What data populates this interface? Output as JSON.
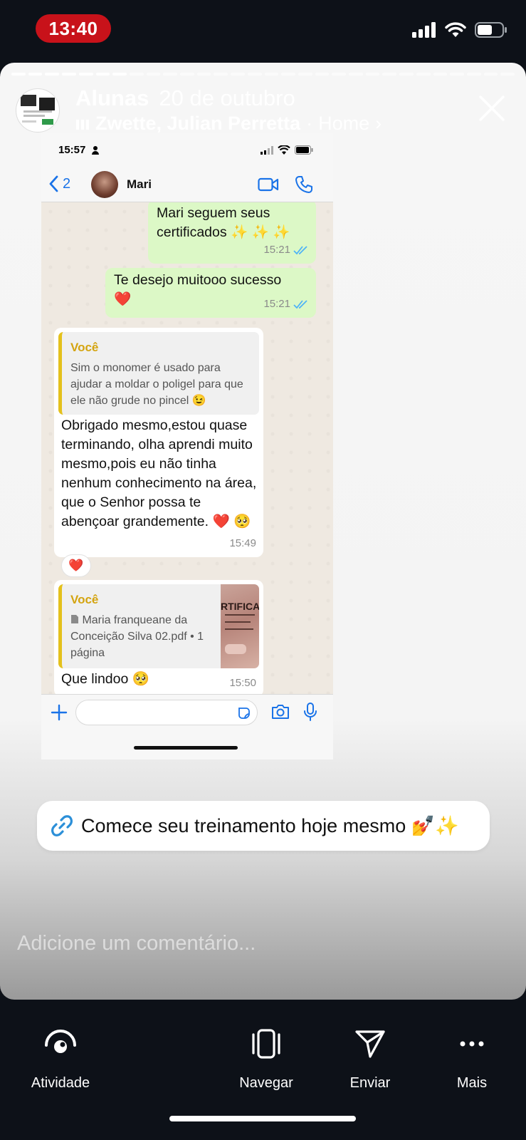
{
  "status_bar": {
    "time": "13:40"
  },
  "story": {
    "title": "Alunas",
    "date": "20 de outubro",
    "subtitle": "Zwette, Julian Perretta",
    "home_link": "Home",
    "link_sticker_text": "Comece seu treinamento hoje mesmo 💅✨",
    "comment_placeholder": "Adicione um comentário..."
  },
  "whatsapp": {
    "status_time": "15:57",
    "back_count": "2",
    "contact_name": "Mari",
    "messages": [
      {
        "text": "Mari seguem seus certificados ✨ ✨ ✨",
        "time": "15:21"
      },
      {
        "text": "Te desejo muitooo sucesso",
        "emoji": "❤️",
        "time": "15:21"
      },
      {
        "quote_author": "Você",
        "quote_text": "Sim o monomer é usado para ajudar a moldar o poligel para que ele não grude no pincel 😉",
        "text": "Obrigado mesmo,estou quase terminando, olha aprendi muito mesmo,pois eu não tinha nenhum conhecimento na área, que o Senhor possa te abençoar grandemente. ❤️ 🥺",
        "time": "15:49",
        "reaction": "❤️"
      },
      {
        "quote_author": "Você",
        "quote_text": "Maria franqueane da Conceição Silva 02.pdf • 1 página",
        "thumb_text": "RTIFICA",
        "text": "Que lindoo 🥺",
        "time": "15:50"
      }
    ]
  },
  "bottom_bar": {
    "items": [
      {
        "label": "Atividade",
        "icon": "activity-icon"
      },
      {
        "label": "Navegar",
        "icon": "browse-icon"
      },
      {
        "label": "Enviar",
        "icon": "send-icon"
      },
      {
        "label": "Mais",
        "icon": "more-icon"
      }
    ]
  }
}
